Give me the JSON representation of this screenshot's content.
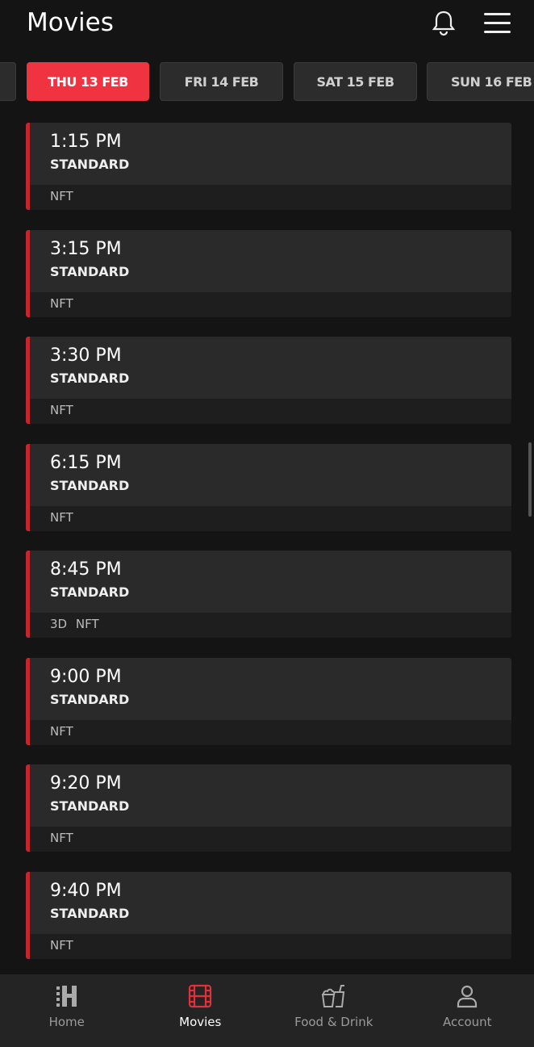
{
  "header": {
    "title": "Movies",
    "icons": [
      "bell-icon",
      "hamburger-menu-icon"
    ]
  },
  "dates": [
    {
      "label": ""
    },
    {
      "label": "THU 13 FEB",
      "active": true
    },
    {
      "label": "FRI 14 FEB"
    },
    {
      "label": "SAT 15 FEB"
    },
    {
      "label": "SUN 16 FEB"
    }
  ],
  "showtimes": [
    {
      "time": "1:15 PM",
      "format": "STANDARD",
      "tags": "NFT"
    },
    {
      "time": "3:15 PM",
      "format": "STANDARD",
      "tags": "NFT"
    },
    {
      "time": "3:30 PM",
      "format": "STANDARD",
      "tags": "NFT"
    },
    {
      "time": "6:15 PM",
      "format": "STANDARD",
      "tags": "NFT"
    },
    {
      "time": "8:45 PM",
      "format": "STANDARD",
      "tags": "3D NFT"
    },
    {
      "time": "9:00 PM",
      "format": "STANDARD",
      "tags": "NFT"
    },
    {
      "time": "9:20 PM",
      "format": "STANDARD",
      "tags": "NFT"
    },
    {
      "time": "9:40 PM",
      "format": "STANDARD",
      "tags": "NFT"
    }
  ],
  "nav": [
    {
      "label": "Home",
      "icon": "home-icon"
    },
    {
      "label": "Movies",
      "icon": "film-icon",
      "active": true
    },
    {
      "label": "Food & Drink",
      "icon": "food-drink-icon"
    },
    {
      "label": "Account",
      "icon": "account-icon"
    }
  ],
  "colors": {
    "accent": "#f03340",
    "card_stripe": "#c4262e",
    "background": "#141414"
  }
}
